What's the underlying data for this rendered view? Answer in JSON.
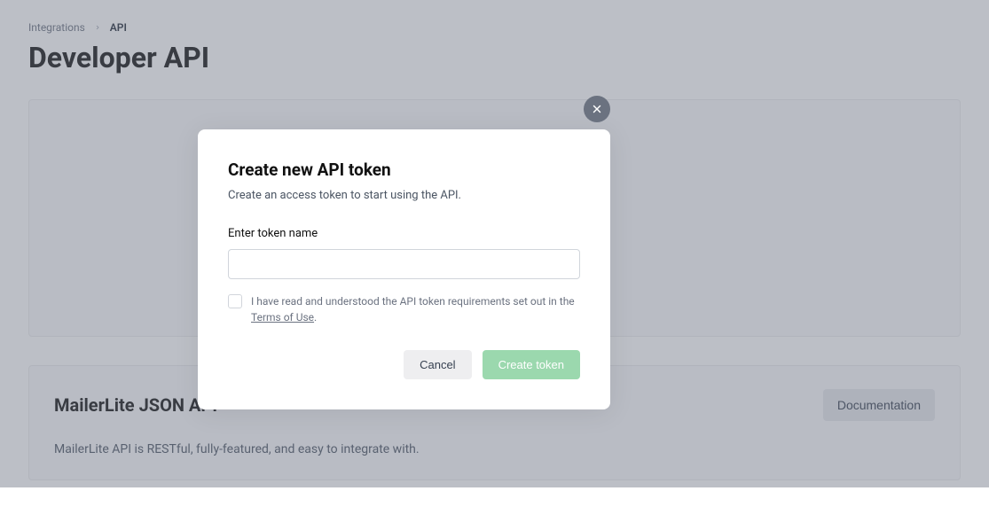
{
  "breadcrumb": {
    "parent": "Integrations",
    "current": "API"
  },
  "page": {
    "title": "Developer API"
  },
  "section2": {
    "title": "MailerLite JSON API",
    "doc_label": "Documentation",
    "description": "MailerLite API is RESTful, fully-featured, and easy to integrate with."
  },
  "modal": {
    "title": "Create new API token",
    "subtitle": "Create an access token to start using the API.",
    "input_label": "Enter token name",
    "input_value": "",
    "consent_prefix": "I have read and understood the API token requirements set out in the ",
    "consent_link": "Terms of Use",
    "consent_suffix": ".",
    "cancel_label": "Cancel",
    "create_label": "Create token"
  }
}
